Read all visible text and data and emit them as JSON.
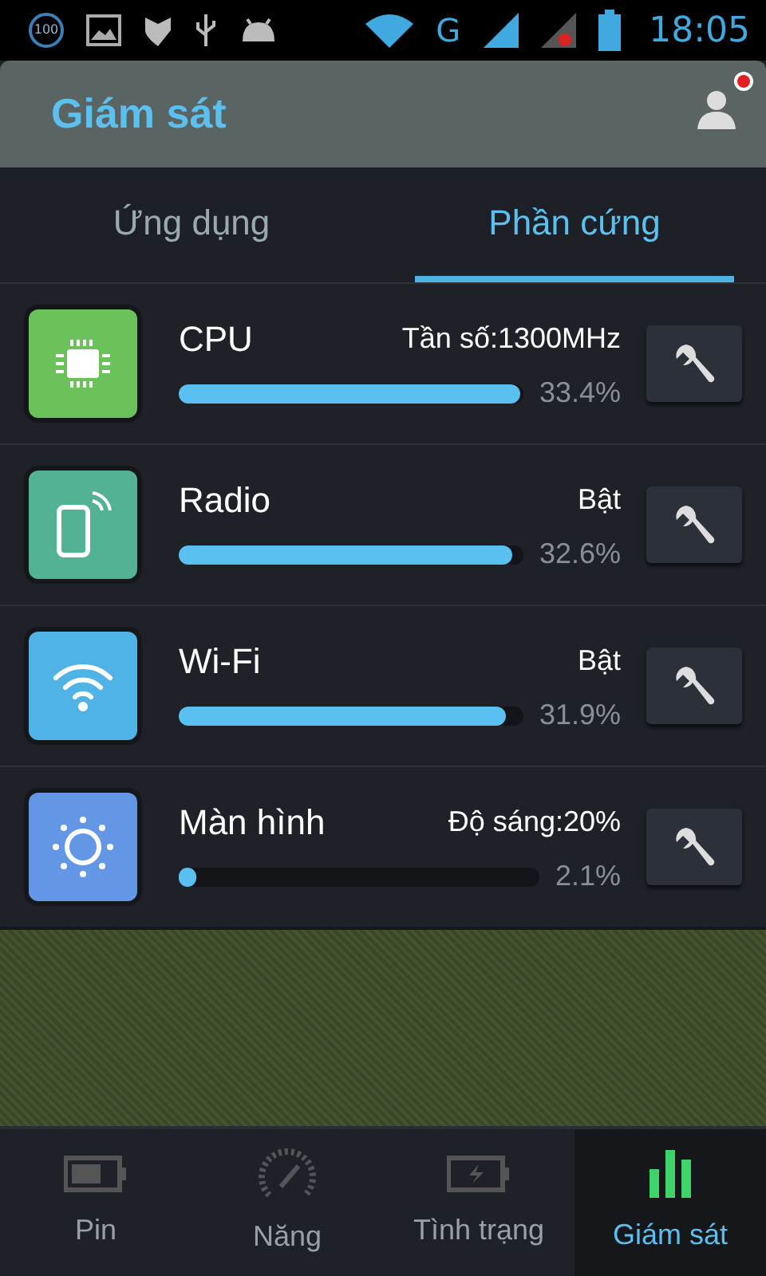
{
  "status_bar": {
    "battery_badge": "100",
    "network": "G",
    "time": "18:05"
  },
  "header": {
    "title": "Giám sát",
    "notification": true
  },
  "tabs": [
    {
      "label": "Ứng dụng",
      "selected": false
    },
    {
      "label": "Phần cứng",
      "selected": true
    }
  ],
  "items": [
    {
      "kind": "cpu",
      "name": "CPU",
      "status": "Tần số:1300MHz",
      "level": 0.99,
      "reading": "33.4%",
      "color": "#6cc25a"
    },
    {
      "kind": "radio",
      "name": "Radio",
      "status": "Bật",
      "level": 0.97,
      "reading": "32.6%",
      "color": "#52b293"
    },
    {
      "kind": "wifi",
      "name": "Wi-Fi",
      "status": "Bật",
      "level": 0.95,
      "reading": "31.9%",
      "color": "#4fb3e6"
    },
    {
      "kind": "screen",
      "name": "Màn hình",
      "status": "Độ sáng:20%",
      "level": 0.04,
      "reading": "2.1%",
      "color": "#6397e6"
    }
  ],
  "bottom_nav": [
    {
      "kind": "battery",
      "label": "Pin",
      "selected": false
    },
    {
      "kind": "gauge",
      "label": "Năng",
      "selected": false
    },
    {
      "kind": "charging",
      "label": "Tình trạng",
      "selected": false
    },
    {
      "kind": "bars",
      "label": "Giám sát",
      "selected": true
    }
  ]
}
